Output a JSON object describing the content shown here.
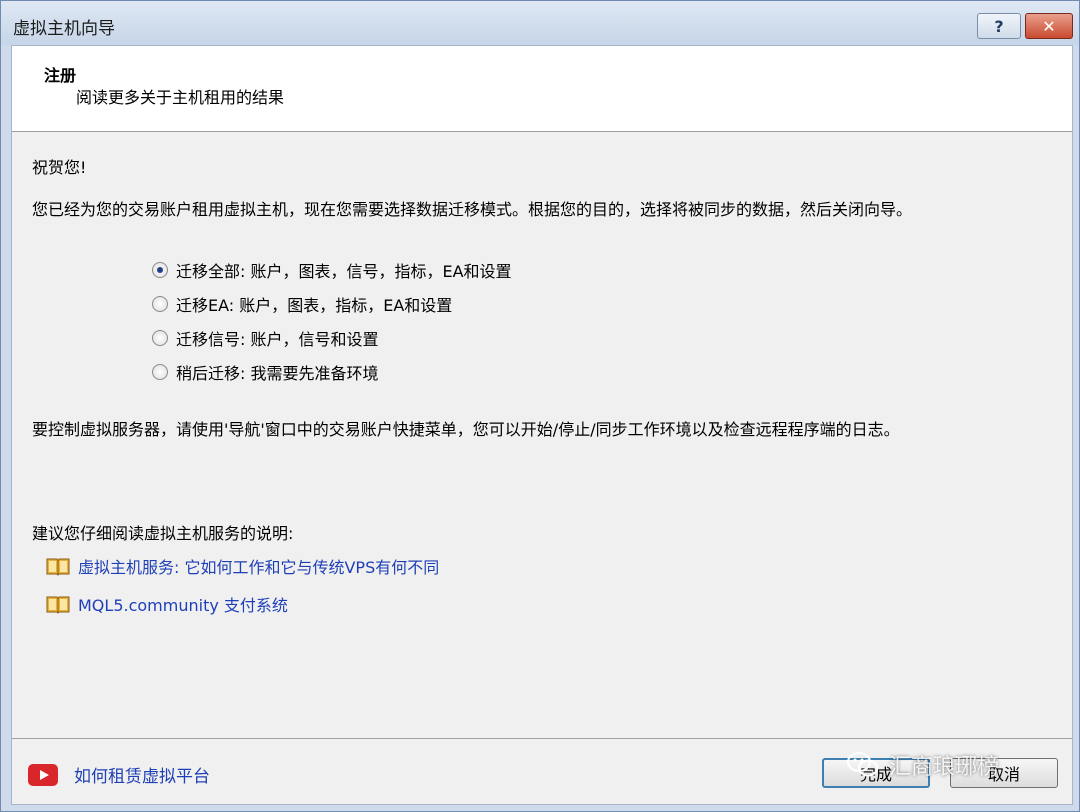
{
  "window": {
    "title": "虚拟主机向导",
    "help_label": "?",
    "close_label": "✕"
  },
  "header": {
    "title": "注册",
    "subtitle": "阅读更多关于主机租用的结果"
  },
  "body": {
    "greeting": "祝贺您!",
    "intro": "您已经为您的交易账户租用虚拟主机，现在您需要选择数据迁移模式。根据您的目的，选择将被同步的数据，然后关闭向导。",
    "options": [
      {
        "label": "迁移全部: 账户，图表，信号，指标，EA和设置",
        "checked": true
      },
      {
        "label": "迁移EA: 账户，图表，指标，EA和设置",
        "checked": false
      },
      {
        "label": "迁移信号: 账户，信号和设置",
        "checked": false
      },
      {
        "label": "稍后迁移: 我需要先准备环境",
        "checked": false
      }
    ],
    "control_note": "要控制虚拟服务器，请使用'导航'窗口中的交易账户快捷菜单，您可以开始/停止/同步工作环境以及检查远程程序端的日志。",
    "recommend": "建议您仔细阅读虚拟主机服务的说明:",
    "links": [
      {
        "label": "虚拟主机服务: 它如何工作和它与传统VPS有何不同",
        "icon": "book-icon"
      },
      {
        "label": "MQL5.community 支付系统",
        "icon": "book-icon"
      }
    ]
  },
  "footer": {
    "video_link": "如何租赁虚拟平台",
    "video_icon": "youtube-icon",
    "finish_label": "完成",
    "cancel_label": "取消"
  },
  "watermark": {
    "text": "汇商琅琊榜",
    "icon": "wechat-icon"
  },
  "colors": {
    "link": "#1f3fb8",
    "radio_dot": "#1f3f86",
    "youtube_red": "#d9262a"
  }
}
